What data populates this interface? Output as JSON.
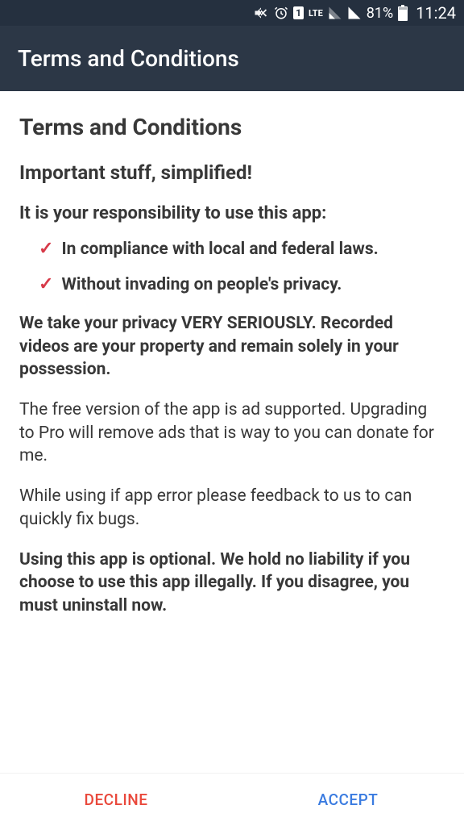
{
  "status": {
    "battery_pct": "81%",
    "time": "11:24",
    "sim_label": "1",
    "lte_label": "LTE"
  },
  "appbar": {
    "title": "Terms and Conditions"
  },
  "content": {
    "title": "Terms and Conditions",
    "subtitle": "Important stuff, simplified!",
    "responsibility_heading": "It is your responsibility to use this app:",
    "bullets": [
      "In compliance with local and federal laws.",
      "Without invading on people's privacy."
    ],
    "privacy_para": "We take your privacy VERY SERIOUSLY. Recorded videos are your property and remain solely in your possession.",
    "free_para": "The free version of the app is ad supported. Upgrading to Pro will remove ads that is way to you can donate for me.",
    "error_para": "While using if app error please feedback to us to can quickly fix bugs.",
    "optional_para": "Using this app is optional. We hold no liability if you choose to use this app illegally. If you disagree, you must uninstall now."
  },
  "buttons": {
    "decline": "DECLINE",
    "accept": "ACCEPT"
  }
}
